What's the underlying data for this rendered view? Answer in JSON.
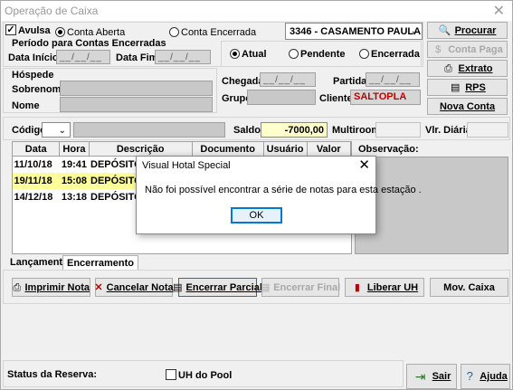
{
  "window": {
    "title": "Operação de Caixa",
    "close": "✕"
  },
  "filters": {
    "avulsa_label": "Avulsa",
    "conta_aberta_label": "Conta Aberta",
    "conta_encerrada_label": "Conta Encerrada",
    "room_select_value": "3346 - CASAMENTO PAULA",
    "periodo_label": "Período para Contas Encerradas",
    "data_inicio_label": "Data Início",
    "data_inicio_value": "__/__/__",
    "data_fim_label": "Data Fim",
    "data_fim_value": "__/__/__",
    "atual_label": "Atual",
    "pendente_label": "Pendente",
    "encerrada_label": "Encerrada"
  },
  "guest": {
    "section_label": "Hóspede",
    "sobrenome_label": "Sobrenome",
    "nome_label": "Nome",
    "chegada_label": "Chegada",
    "chegada_value": "__/__/__",
    "partida_label": "Partida",
    "partida_value": "__/__/__",
    "grupo_label": "Grupo",
    "cliente_label": "Cliente",
    "cliente_value": "SALTOPLA"
  },
  "side_buttons": {
    "procurar": "Procurar",
    "conta_paga": "Conta Paga",
    "extrato": "Extrato",
    "rps": "RPS",
    "nova_conta": "Nova Conta"
  },
  "account": {
    "codigo_label": "Código",
    "saldo_label": "Saldo",
    "saldo_value": "-7000,00",
    "multiroom_label": "Multiroom",
    "vlr_diaria_label": "Vlr. Diária",
    "observacao_label": "Observação:"
  },
  "table": {
    "headers": [
      "Data",
      "Hora",
      "Descrição",
      "Documento",
      "Usuário",
      "Valor"
    ],
    "rows": [
      {
        "data": "11/10/18",
        "hora": "19:41",
        "descricao": "DEPÓSITO"
      },
      {
        "data": "19/11/18",
        "hora": "15:08",
        "descricao": "DEPÓSITO"
      },
      {
        "data": "14/12/18",
        "hora": "13:18",
        "descricao": "DEPÓSITO"
      }
    ]
  },
  "tabs": [
    "Lançamento",
    "Encerramento"
  ],
  "actions": {
    "imprimir_nota": "Imprimir Nota",
    "cancelar_nota": "Cancelar Nota",
    "encerrar_parcial": "Encerrar Parcial",
    "encerrar_final": "Encerrar Final",
    "liberar_uh": "Liberar UH",
    "mov_caixa": "Mov. Caixa"
  },
  "footer": {
    "status_label": "Status da Reserva:",
    "uh_do_pool_label": "UH do Pool",
    "sair": "Sair",
    "ajuda": "Ajuda"
  },
  "dialog": {
    "title": "Visual Hotal Special",
    "message": "Não foi possível encontrar a série de notas para esta estação .",
    "ok": "OK"
  },
  "colors": {
    "selected_row": "#ffff99",
    "saldo_bg": "#ffffcc",
    "cliente_text": "#c00000",
    "dialog_accent": "#0078d7"
  }
}
